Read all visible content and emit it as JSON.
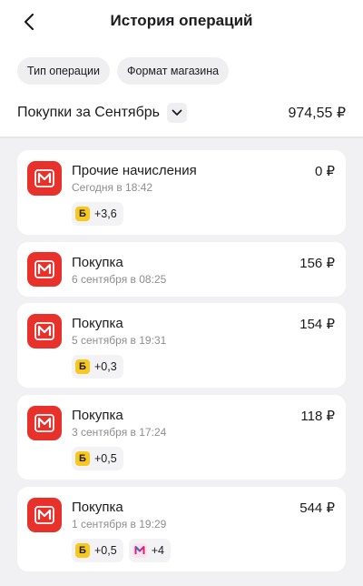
{
  "header": {
    "title": "История операций",
    "back_icon": "chevron-left-icon"
  },
  "filters": {
    "chip1": "Тип операции",
    "chip2": "Формат магазина"
  },
  "period": {
    "label": "Покупки за Сентябрь",
    "total": "974,55 ₽"
  },
  "colors": {
    "brand_red": "#e8312b",
    "bonus_yellow": "#f8c81e",
    "bonus_magenta": "#d4237a"
  },
  "operations": [
    {
      "name": "Прочие начисления",
      "date": "Сегодня в 18:42",
      "amount": "0 ₽",
      "bonus_b": "+3,6"
    },
    {
      "name": "Покупка",
      "date": "6 сентября в 08:25",
      "amount": "156 ₽"
    },
    {
      "name": "Покупка",
      "date": "5 сентября в 19:31",
      "amount": "154 ₽",
      "bonus_b": "+0,3"
    },
    {
      "name": "Покупка",
      "date": "3 сентября в 17:24",
      "amount": "118 ₽",
      "bonus_b": "+0,5"
    },
    {
      "name": "Покупка",
      "date": "1 сентября в 19:29",
      "amount": "544 ₽",
      "bonus_b": "+0,5",
      "bonus_m": "+4"
    }
  ],
  "bonus_letter": "Б"
}
